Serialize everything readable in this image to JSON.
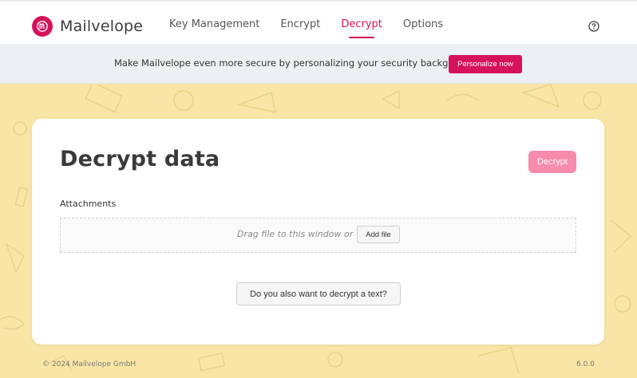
{
  "app": {
    "name": "Mailvelope"
  },
  "nav": {
    "items": [
      {
        "label": "Key Management",
        "active": false
      },
      {
        "label": "Encrypt",
        "active": false
      },
      {
        "label": "Decrypt",
        "active": true
      },
      {
        "label": "Options",
        "active": false
      }
    ],
    "help_icon": "question-circle-icon"
  },
  "banner": {
    "text": "Make Mailvelope even more secure by personalizing your security background.",
    "button_label": "Personalize now"
  },
  "main": {
    "title": "Decrypt data",
    "decrypt_button": "Decrypt",
    "attachments_label": "Attachments",
    "dropzone_text": "Drag file to this window or",
    "add_file_button": "Add file",
    "decrypt_text_button": "Do you also want to decrypt a text?"
  },
  "footer": {
    "copyright": "© 2024  Mailvelope GmbH",
    "version": "6.0.0"
  },
  "colors": {
    "accent": "#d6135a",
    "background_pattern": "#f9e6a6",
    "decrypt_button_disabled": "#f68bab"
  }
}
